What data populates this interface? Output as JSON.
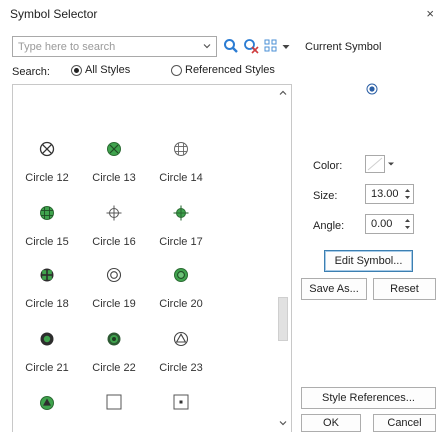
{
  "window": {
    "title": "Symbol Selector",
    "close_glyph": "×"
  },
  "search": {
    "placeholder": "Type here to search",
    "value": "",
    "label": "Search:",
    "scope_options": [
      {
        "label": "All Styles",
        "checked": true
      },
      {
        "label": "Referenced Styles",
        "checked": false
      }
    ]
  },
  "toolbar": {
    "icons": [
      "search-icon",
      "clear-search-icon",
      "view-options-icon",
      "chevron-down-icon"
    ]
  },
  "gallery": {
    "symbols": [
      {
        "label": "Circle 12",
        "icon": "circle-x"
      },
      {
        "label": "Circle 13",
        "icon": "circle-x-green"
      },
      {
        "label": "Circle 14",
        "icon": "circle-grid"
      },
      {
        "label": "Circle 15",
        "icon": "circle-grid-green"
      },
      {
        "label": "Circle 16",
        "icon": "circle-crosshair"
      },
      {
        "label": "Circle 17",
        "icon": "circle-crosshair-green"
      },
      {
        "label": "Circle 18",
        "icon": "circle-quad-green"
      },
      {
        "label": "Circle 19",
        "icon": "circle-double-ring"
      },
      {
        "label": "Circle 20",
        "icon": "circle-green-ring"
      },
      {
        "label": "Circle 21",
        "icon": "circle-dot-green"
      },
      {
        "label": "Circle 22",
        "icon": "circle-ring-dark"
      },
      {
        "label": "Circle 23",
        "icon": "circle-triangle"
      },
      {
        "label": "",
        "icon": "circle-triangle-green"
      },
      {
        "label": "",
        "icon": "square-outline"
      },
      {
        "label": "",
        "icon": "square-dot"
      }
    ]
  },
  "current_symbol": {
    "label": "Current Symbol",
    "color_label": "Color:",
    "size_label": "Size:",
    "size_value": "13.00",
    "angle_label": "Angle:",
    "angle_value": "0.00",
    "edit_button": "Edit Symbol...",
    "save_as_button": "Save As...",
    "reset_button": "Reset",
    "style_references_button": "Style References...",
    "ok_button": "OK",
    "cancel_button": "Cancel"
  },
  "colors": {
    "symbol_green": "#3fa34d",
    "symbol_dark": "#333333",
    "focus_blue": "#3c7fb1",
    "search_icon_blue": "#2b7cd3",
    "clear_icon_red": "#d23c3c"
  }
}
